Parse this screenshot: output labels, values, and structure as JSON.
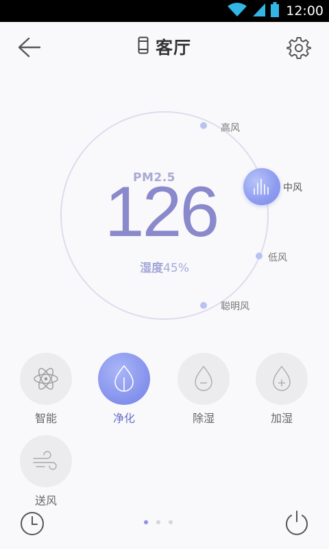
{
  "status_bar": {
    "time": "12:00",
    "icons": [
      "wifi-icon",
      "signal-icon",
      "battery-icon"
    ]
  },
  "header": {
    "title": "客厅",
    "back_icon": "arrow-left-icon",
    "device_icon": "air-purifier-icon",
    "settings_icon": "gear-icon"
  },
  "dial": {
    "pm_label": "PM2.5",
    "pm_value": "126",
    "humidity_label": "湿度",
    "humidity_value": "45%",
    "speeds": [
      {
        "label": "高风"
      },
      {
        "label": "中风",
        "selected": true
      },
      {
        "label": "低风"
      },
      {
        "label": "聪明风"
      }
    ]
  },
  "modes": [
    {
      "label": "智能",
      "icon": "atom-icon",
      "active": false
    },
    {
      "label": "净化",
      "icon": "leaf-drop-icon",
      "active": true
    },
    {
      "label": "除湿",
      "icon": "drop-minus-icon",
      "active": false
    },
    {
      "label": "加湿",
      "icon": "drop-plus-icon",
      "active": false
    },
    {
      "label": "送风",
      "icon": "wind-icon",
      "active": false
    }
  ],
  "bottom": {
    "timer_icon": "clock-icon",
    "power_icon": "power-icon",
    "pages": 3,
    "current_page": 1
  },
  "colors": {
    "accent": "#8390ec",
    "accent_text": "#6a6fc8",
    "ring": "#d9d9ec",
    "statusbar": "#000000"
  }
}
